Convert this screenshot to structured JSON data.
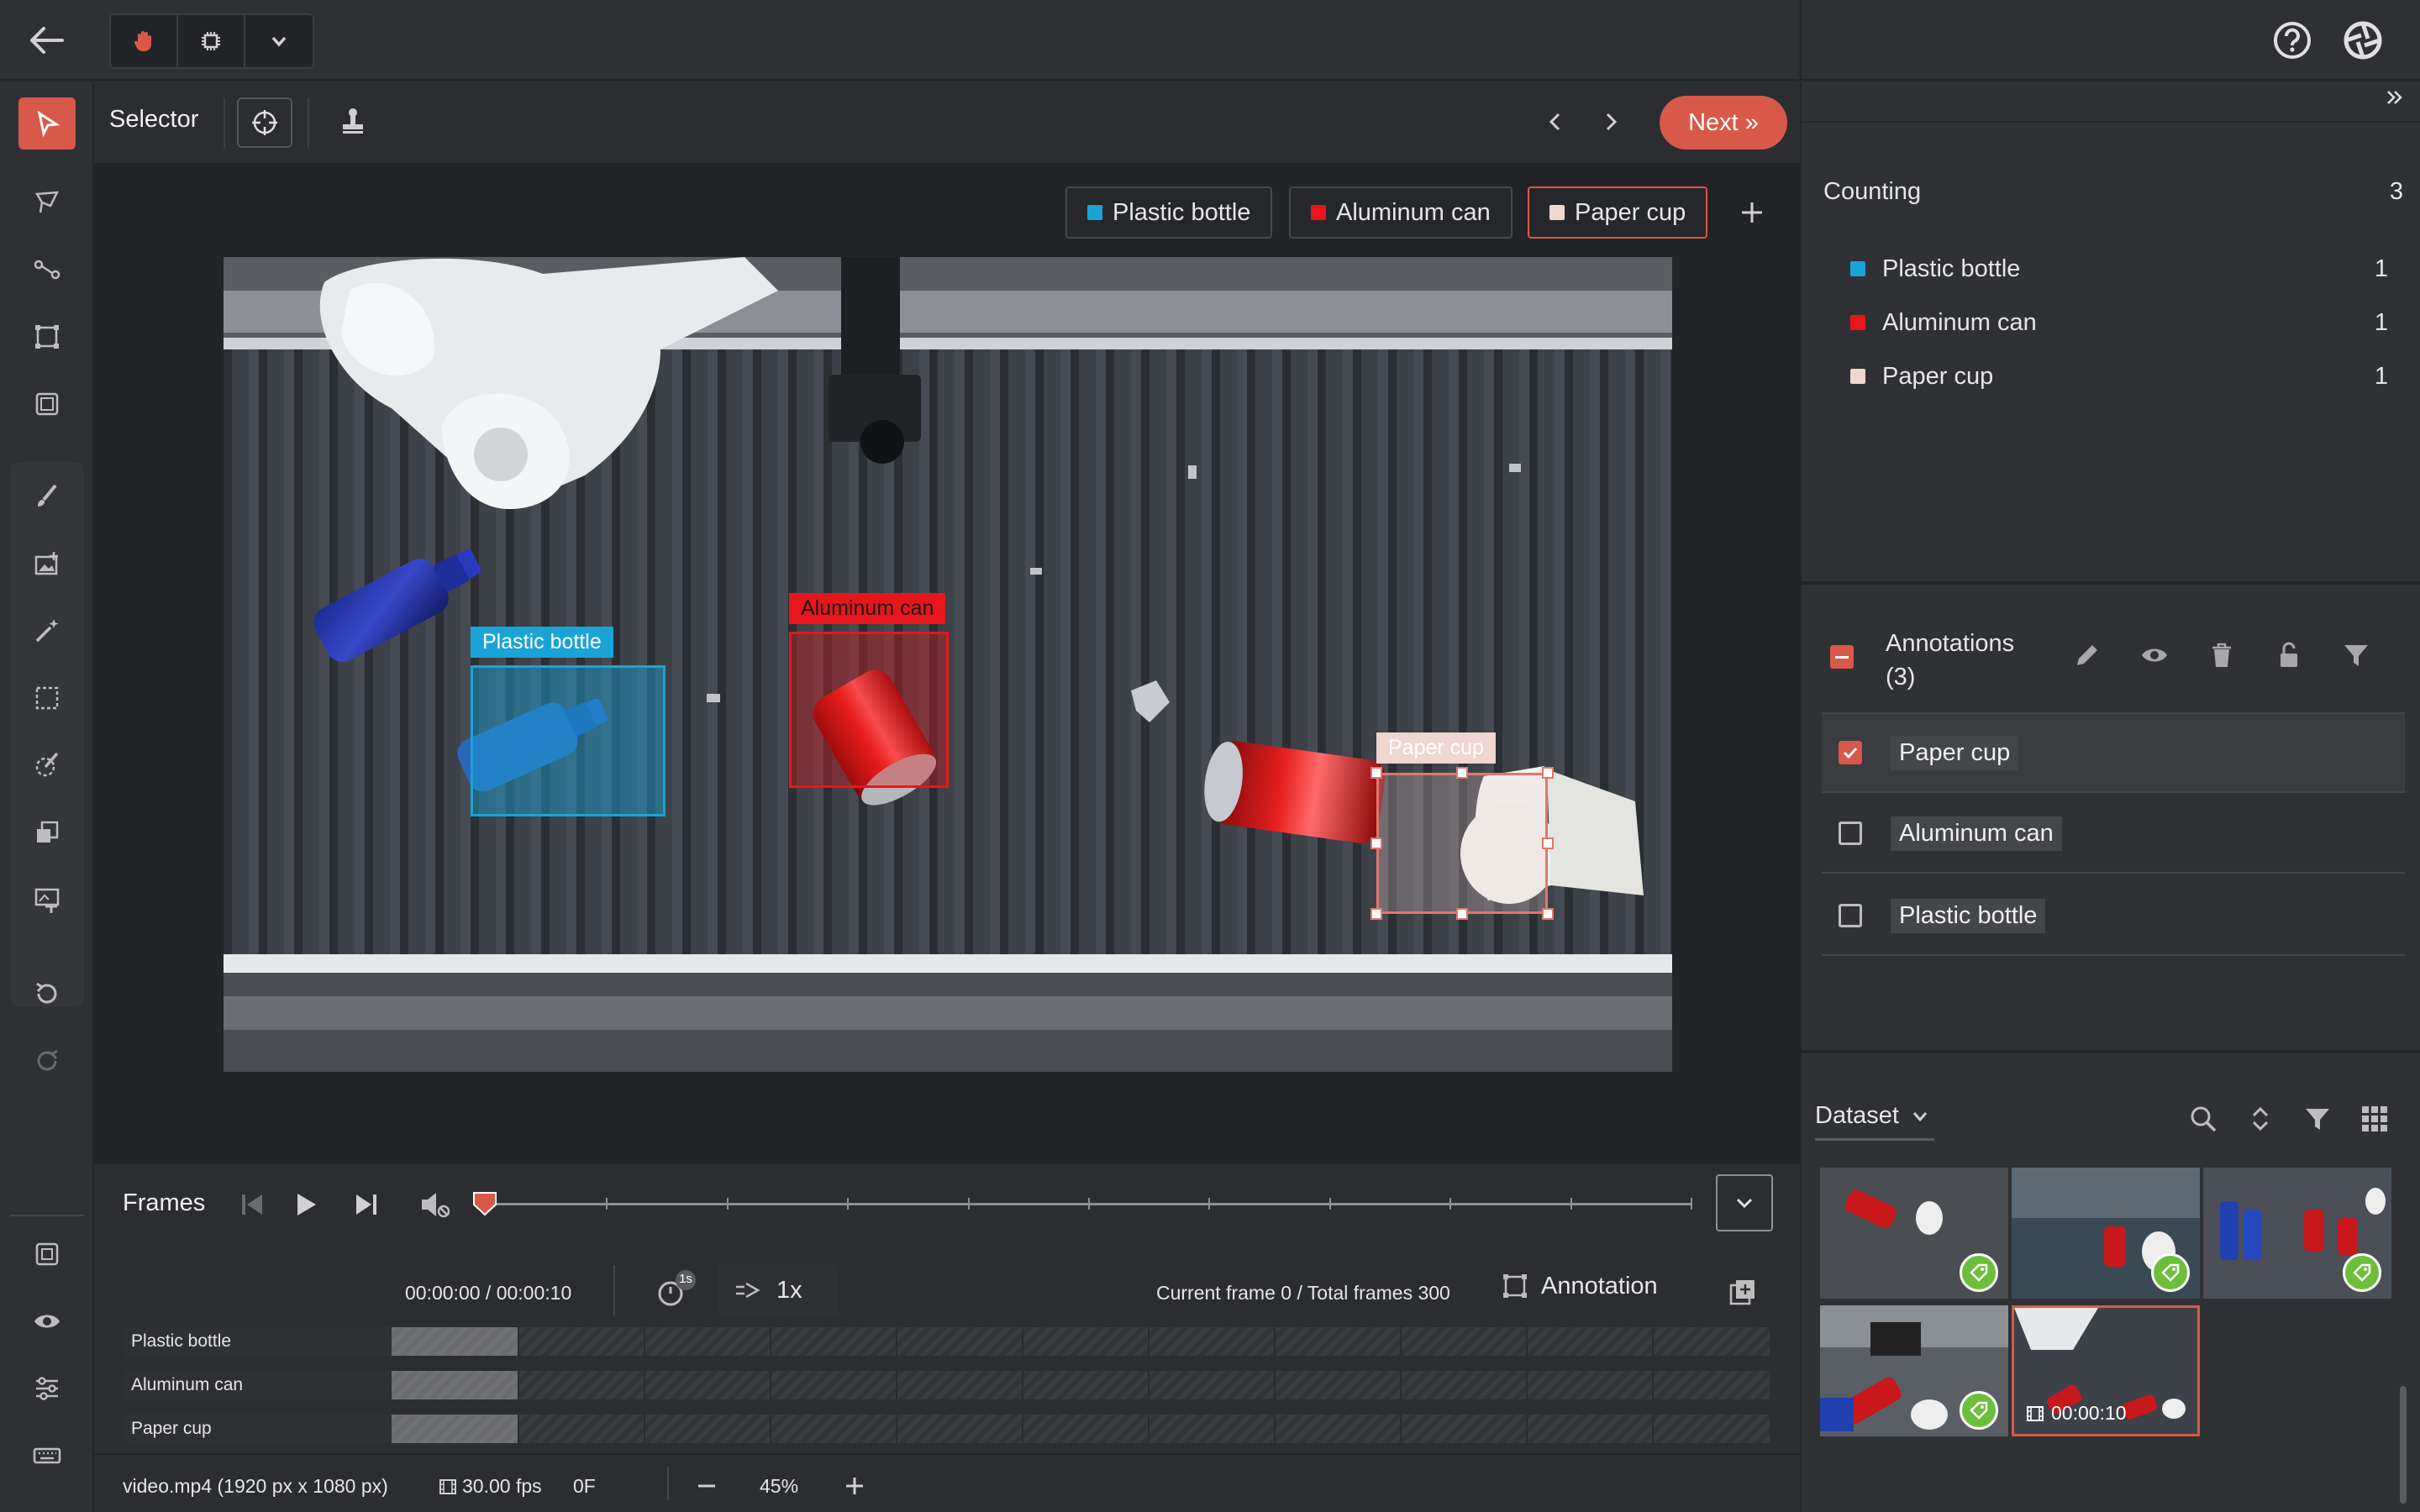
{
  "toolbar": {
    "selector_label": "Selector",
    "next_label": "Next »"
  },
  "classes": [
    {
      "name": "Plastic bottle",
      "color": "#1aa3d6"
    },
    {
      "name": "Aluminum can",
      "color": "#e8161b"
    },
    {
      "name": "Paper cup",
      "color": "#f0d5d0"
    }
  ],
  "canvas": {
    "labels": {
      "plastic_bottle": "Plastic bottle",
      "aluminum_can": "Aluminum can",
      "paper_cup": "Paper cup"
    }
  },
  "frames": {
    "title": "Frames",
    "time": "00:00:00 / 00:00:10",
    "speed": "1x",
    "interval_badge": "1s",
    "frame_info": "Current frame 0 / Total frames 300",
    "annotation_label": "Annotation",
    "tracks": [
      "Plastic bottle",
      "Aluminum can",
      "Paper cup"
    ],
    "playhead_fraction": 0
  },
  "status": {
    "file": "video.mp4 (1920 px x 1080 px)",
    "fps": "30.00 fps",
    "frame": "0F",
    "zoom": "45%"
  },
  "counting": {
    "title": "Counting",
    "total": "3",
    "items": [
      {
        "name": "Plastic bottle",
        "count": "1",
        "color": "#1aa3d6"
      },
      {
        "name": "Aluminum can",
        "count": "1",
        "color": "#e8161b"
      },
      {
        "name": "Paper cup",
        "count": "1",
        "color": "#f0d5d0"
      }
    ]
  },
  "annotations": {
    "title": "Annotations",
    "count": "(3)",
    "items": [
      {
        "label": "Paper cup",
        "checked": true
      },
      {
        "label": "Aluminum can",
        "checked": false
      },
      {
        "label": "Plastic bottle",
        "checked": false
      }
    ]
  },
  "dataset": {
    "title": "Dataset",
    "video_duration": "00:00:10"
  },
  "icons": {
    "back": "arrow-left-icon",
    "hand": "hand-icon",
    "chip": "chip-icon",
    "help": "help-icon",
    "logo": "aperture-logo-icon"
  }
}
